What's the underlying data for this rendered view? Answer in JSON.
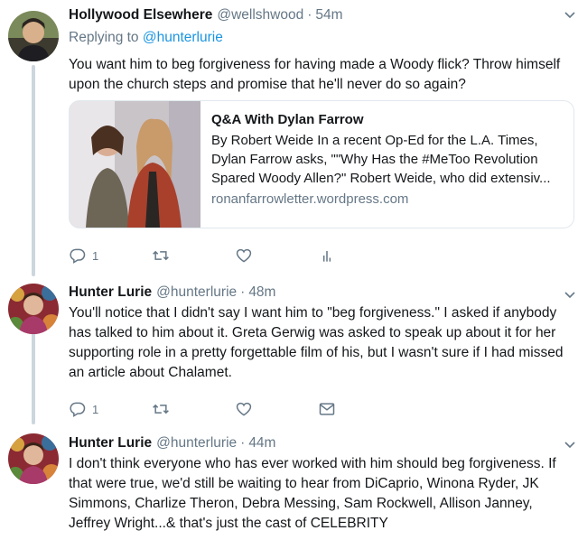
{
  "tweets": [
    {
      "name": "Hollywood Elsewhere",
      "handle": "@wellshwood",
      "separator": "·",
      "time": "54m",
      "replying_prefix": "Replying to",
      "replying_to": "@hunterlurie",
      "text": "You want him to beg forgiveness for having made a Woody flick? Throw himself upon the church steps and promise that he'll never do so again?",
      "card": {
        "title": "Q&A With Dylan Farrow",
        "description": "By Robert Weide In a recent Op-Ed for the L.A. Times, Dylan Farrow asks, \"\"Why Has the #MeToo Revolution Spared Woody Allen?\" Robert Weide, who did extensiv...",
        "domain": "ronanfarrowletter.wordpress.com"
      },
      "actions": {
        "reply_count": "1"
      }
    },
    {
      "name": "Hunter Lurie",
      "handle": "@hunterlurie",
      "separator": "·",
      "time": "48m",
      "text": "You'll notice that I didn't say I want him to \"beg forgiveness.\" I asked if anybody has talked to him about it. Greta Gerwig was asked to speak up about it for her supporting role in a pretty forgettable film of his, but I wasn't sure if I had missed an article about Chalamet.",
      "actions": {
        "reply_count": "1"
      }
    },
    {
      "name": "Hunter Lurie",
      "handle": "@hunterlurie",
      "separator": "·",
      "time": "44m",
      "text": "I don't think everyone who has ever worked with him should beg forgiveness. If that were true, we'd still be waiting to hear from DiCaprio, Winona Ryder, JK Simmons, Charlize Theron, Debra Messing, Sam Rockwell, Allison Janney, Jeffrey Wright...& that's just the cast of CELEBRITY"
    }
  ],
  "icons": [
    "reply-icon",
    "retweet-icon",
    "like-icon",
    "analytics-icon",
    "message-icon",
    "chevron-down-icon"
  ],
  "colors": {
    "link": "#1b95e0",
    "secondary": "#657786",
    "border": "#e1e8ed",
    "thread": "#ccd6dd"
  }
}
